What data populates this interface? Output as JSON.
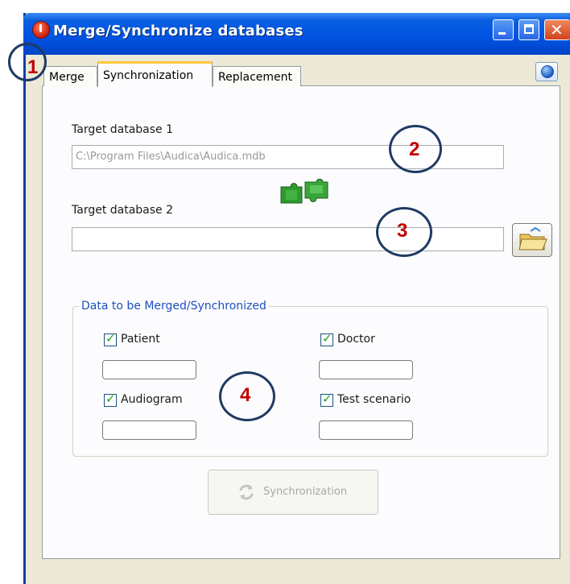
{
  "window": {
    "title": "Merge/Synchronize databases"
  },
  "tabs": [
    {
      "label": "Merge",
      "selected": false
    },
    {
      "label": "Synchronization",
      "selected": true
    },
    {
      "label": "Replacement",
      "selected": false
    }
  ],
  "icons": {
    "app": "app-logo-icon",
    "help": "help-icon",
    "folder": "folder-browse-icon",
    "puzzle": "puzzle-merge-icon",
    "sync": "sync-arrows-icon"
  },
  "form": {
    "target1_label": "Target database 1",
    "target1_value": "C:\\Program Files\\Audica\\Audica.mdb",
    "target2_label": "Target database 2",
    "target2_value": ""
  },
  "group": {
    "legend": "Data to be Merged/Synchronized",
    "items": [
      {
        "label": "Patient",
        "checked": true,
        "count": ""
      },
      {
        "label": "Doctor",
        "checked": true,
        "count": ""
      },
      {
        "label": "Audiogram",
        "checked": true,
        "count": ""
      },
      {
        "label": "Test scenario",
        "checked": true,
        "count": ""
      }
    ]
  },
  "actions": {
    "sync_label": "Synchronization",
    "sync_enabled": false
  },
  "annotations": [
    "1",
    "2",
    "3",
    "4"
  ],
  "colors": {
    "titlebar": "#0054e3",
    "tab_highlight": "#ffc83c",
    "annotation_text": "#c00000",
    "annotation_ring": "#1f3a64",
    "group_legend": "#1c4fbd"
  }
}
